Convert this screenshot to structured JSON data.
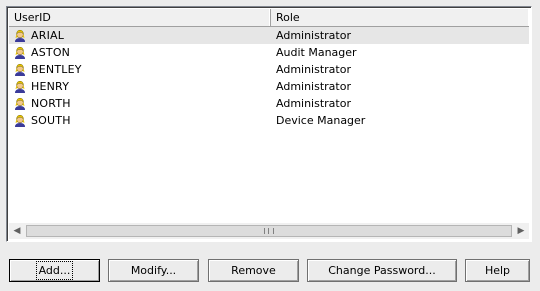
{
  "columns": {
    "userid": "UserID",
    "role": "Role"
  },
  "users": [
    {
      "userid": "ARIAL",
      "role": "Administrator",
      "icon": "user-icon"
    },
    {
      "userid": "ASTON",
      "role": "Audit Manager",
      "icon": "user-icon"
    },
    {
      "userid": "BENTLEY",
      "role": "Administrator",
      "icon": "user-icon"
    },
    {
      "userid": "HENRY",
      "role": "Administrator",
      "icon": "user-icon"
    },
    {
      "userid": "NORTH",
      "role": "Administrator",
      "icon": "user-icon"
    },
    {
      "userid": "SOUTH",
      "role": "Device Manager",
      "icon": "user-icon"
    }
  ],
  "buttons": {
    "add": "Add...",
    "modify": "Modify...",
    "remove": "Remove",
    "change_password": "Change Password...",
    "help": "Help"
  },
  "colors": {
    "selected_row": "#e6e6e6",
    "background": "#ececec"
  }
}
